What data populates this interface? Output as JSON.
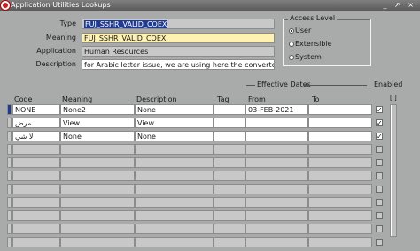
{
  "window": {
    "title": "Application Utilities Lookups",
    "controls": "_ ↗ ×"
  },
  "header": {
    "type_label": "Type",
    "type_value": "FUJ_SSHR_VALID_COEX",
    "meaning_label": "Meaning",
    "meaning_value": "FUJ_SSHR_VALID_COEX",
    "application_label": "Application",
    "application_value": "Human Resources",
    "description_label": "Description",
    "description_value": "for Arabic letter issue, we are using here the converter"
  },
  "access_level": {
    "legend": "Access Level",
    "options": [
      "User",
      "Extensible",
      "System"
    ],
    "selected": "User"
  },
  "grid": {
    "effective_dates_label": "Effective Dates",
    "enabled_label": "Enabled",
    "dots_label": "[ ]",
    "columns": [
      "Code",
      "Meaning",
      "Description",
      "Tag",
      "From",
      "To"
    ],
    "rows": [
      {
        "code": "NONE",
        "meaning": "None2",
        "description": "None",
        "tag": "",
        "from": "03-FEB-2021",
        "to": "",
        "enabled": true
      },
      {
        "code": "مرض",
        "meaning": "View",
        "description": "View",
        "tag": "",
        "from": "",
        "to": "",
        "enabled": true
      },
      {
        "code": "لا شي",
        "meaning": "None",
        "description": "None",
        "tag": "",
        "from": "",
        "to": "",
        "enabled": true
      }
    ],
    "empty_rows": 8
  }
}
